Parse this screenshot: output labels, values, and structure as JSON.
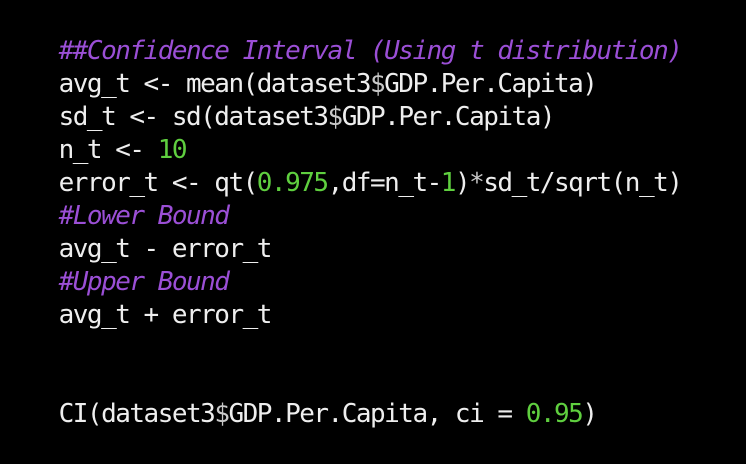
{
  "code": {
    "l1_comment": "##Confidence Interval (Using t distribution)",
    "l2_a": "avg_t <- mean(dataset3",
    "l2_op": "$",
    "l2_b": "GDP.Per.Capita)",
    "l3_a": "sd_t <- sd(dataset3",
    "l3_op": "$",
    "l3_b": "GDP.Per.Capita)",
    "l4_a": "n_t <- ",
    "l4_num": "10",
    "l5_a": "error_t <- qt(",
    "l5_num1": "0.975",
    "l5_b": ",df=n_t-",
    "l5_num2": "1",
    "l5_c": ")",
    "l5_op": "*",
    "l5_d": "sd_t/sqrt(n_t)",
    "l6_comment": "#Lower Bound",
    "l7_a": "avg_t - error_t",
    "l8_comment": "#Upper Bound",
    "l9_a": "avg_t + error_t",
    "l12_a": "CI(dataset3",
    "l12_op": "$",
    "l12_b": "GDP.Per.Capita, ci = ",
    "l12_num": "0.95",
    "l12_c": ")"
  },
  "colors": {
    "background": "#000000",
    "comment": "#9b4fd6",
    "number": "#5fcf3f",
    "text": "#eeeeee"
  }
}
